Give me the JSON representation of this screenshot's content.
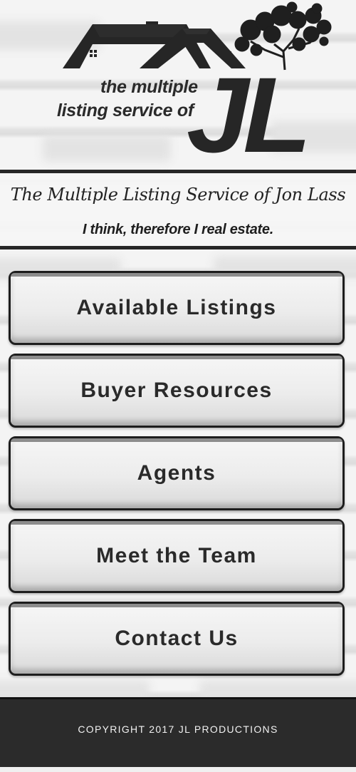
{
  "logo": {
    "line1": "the multiple",
    "line2": "listing service of",
    "mark": "JL"
  },
  "tagline": {
    "title": "The Multiple Listing Service of Jon Lass",
    "subtitle": "I think, therefore I real estate."
  },
  "nav": {
    "items": [
      {
        "label": "Available Listings"
      },
      {
        "label": "Buyer Resources"
      },
      {
        "label": "Agents"
      },
      {
        "label": "Meet the Team"
      },
      {
        "label": "Contact Us"
      }
    ]
  },
  "footer": {
    "copyright": "COPYRIGHT 2017 JL PRODUCTIONS"
  },
  "colors": {
    "dark": "#262626",
    "button_face": "#ececec",
    "footer_bg": "#2b2b2b",
    "footer_text": "#f2f2f2"
  }
}
